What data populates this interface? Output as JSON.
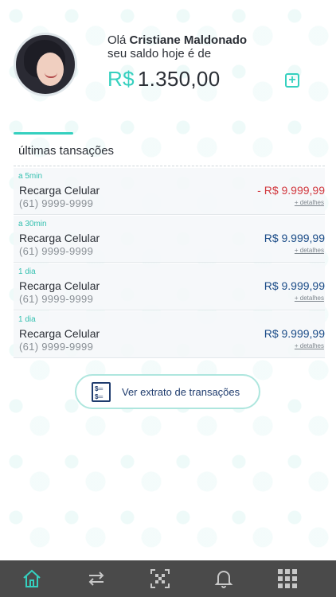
{
  "header": {
    "greeting_prefix": "Olá",
    "user_name": "Cristiane Maldonado",
    "balance_caption": "seu saldo hoje é de",
    "currency": "R$",
    "balance": "1.350,00",
    "add_icon": "plus-square-icon"
  },
  "transactions": {
    "title": "últimas tansações",
    "items": [
      {
        "time": "a 5min",
        "title": "Recarga Celular",
        "phone": "(61) 9999-9999",
        "amount": "- R$ 9.999,99",
        "details": "+ detalhes",
        "negative": true
      },
      {
        "time": "a 30min",
        "title": "Recarga Celular",
        "phone": "(61) 9999-9999",
        "amount": "R$ 9.999,99",
        "details": "+ detalhes",
        "negative": false
      },
      {
        "time": "1 dia",
        "title": "Recarga Celular",
        "phone": "(61) 9999-9999",
        "amount": "R$ 9.999,99",
        "details": "+ detalhes",
        "negative": false
      },
      {
        "time": "1 dia",
        "title": "Recarga Celular",
        "phone": "(61) 9999-9999",
        "amount": "R$ 9.999,99",
        "details": "+ detalhes",
        "negative": false
      }
    ]
  },
  "statement_button": {
    "label": "Ver extrato de transações",
    "icon": "statement-document-icon"
  },
  "bottom_nav": {
    "items": [
      "home-icon",
      "transfer-arrows-icon",
      "qr-code-icon",
      "bell-icon",
      "grid-menu-icon"
    ],
    "active_color": "#35d0bf"
  },
  "colors": {
    "accent": "#35d0bf",
    "positive_amount": "#1b4c88",
    "negative_amount": "#d2393f",
    "nav_background": "#4a4a4a"
  }
}
